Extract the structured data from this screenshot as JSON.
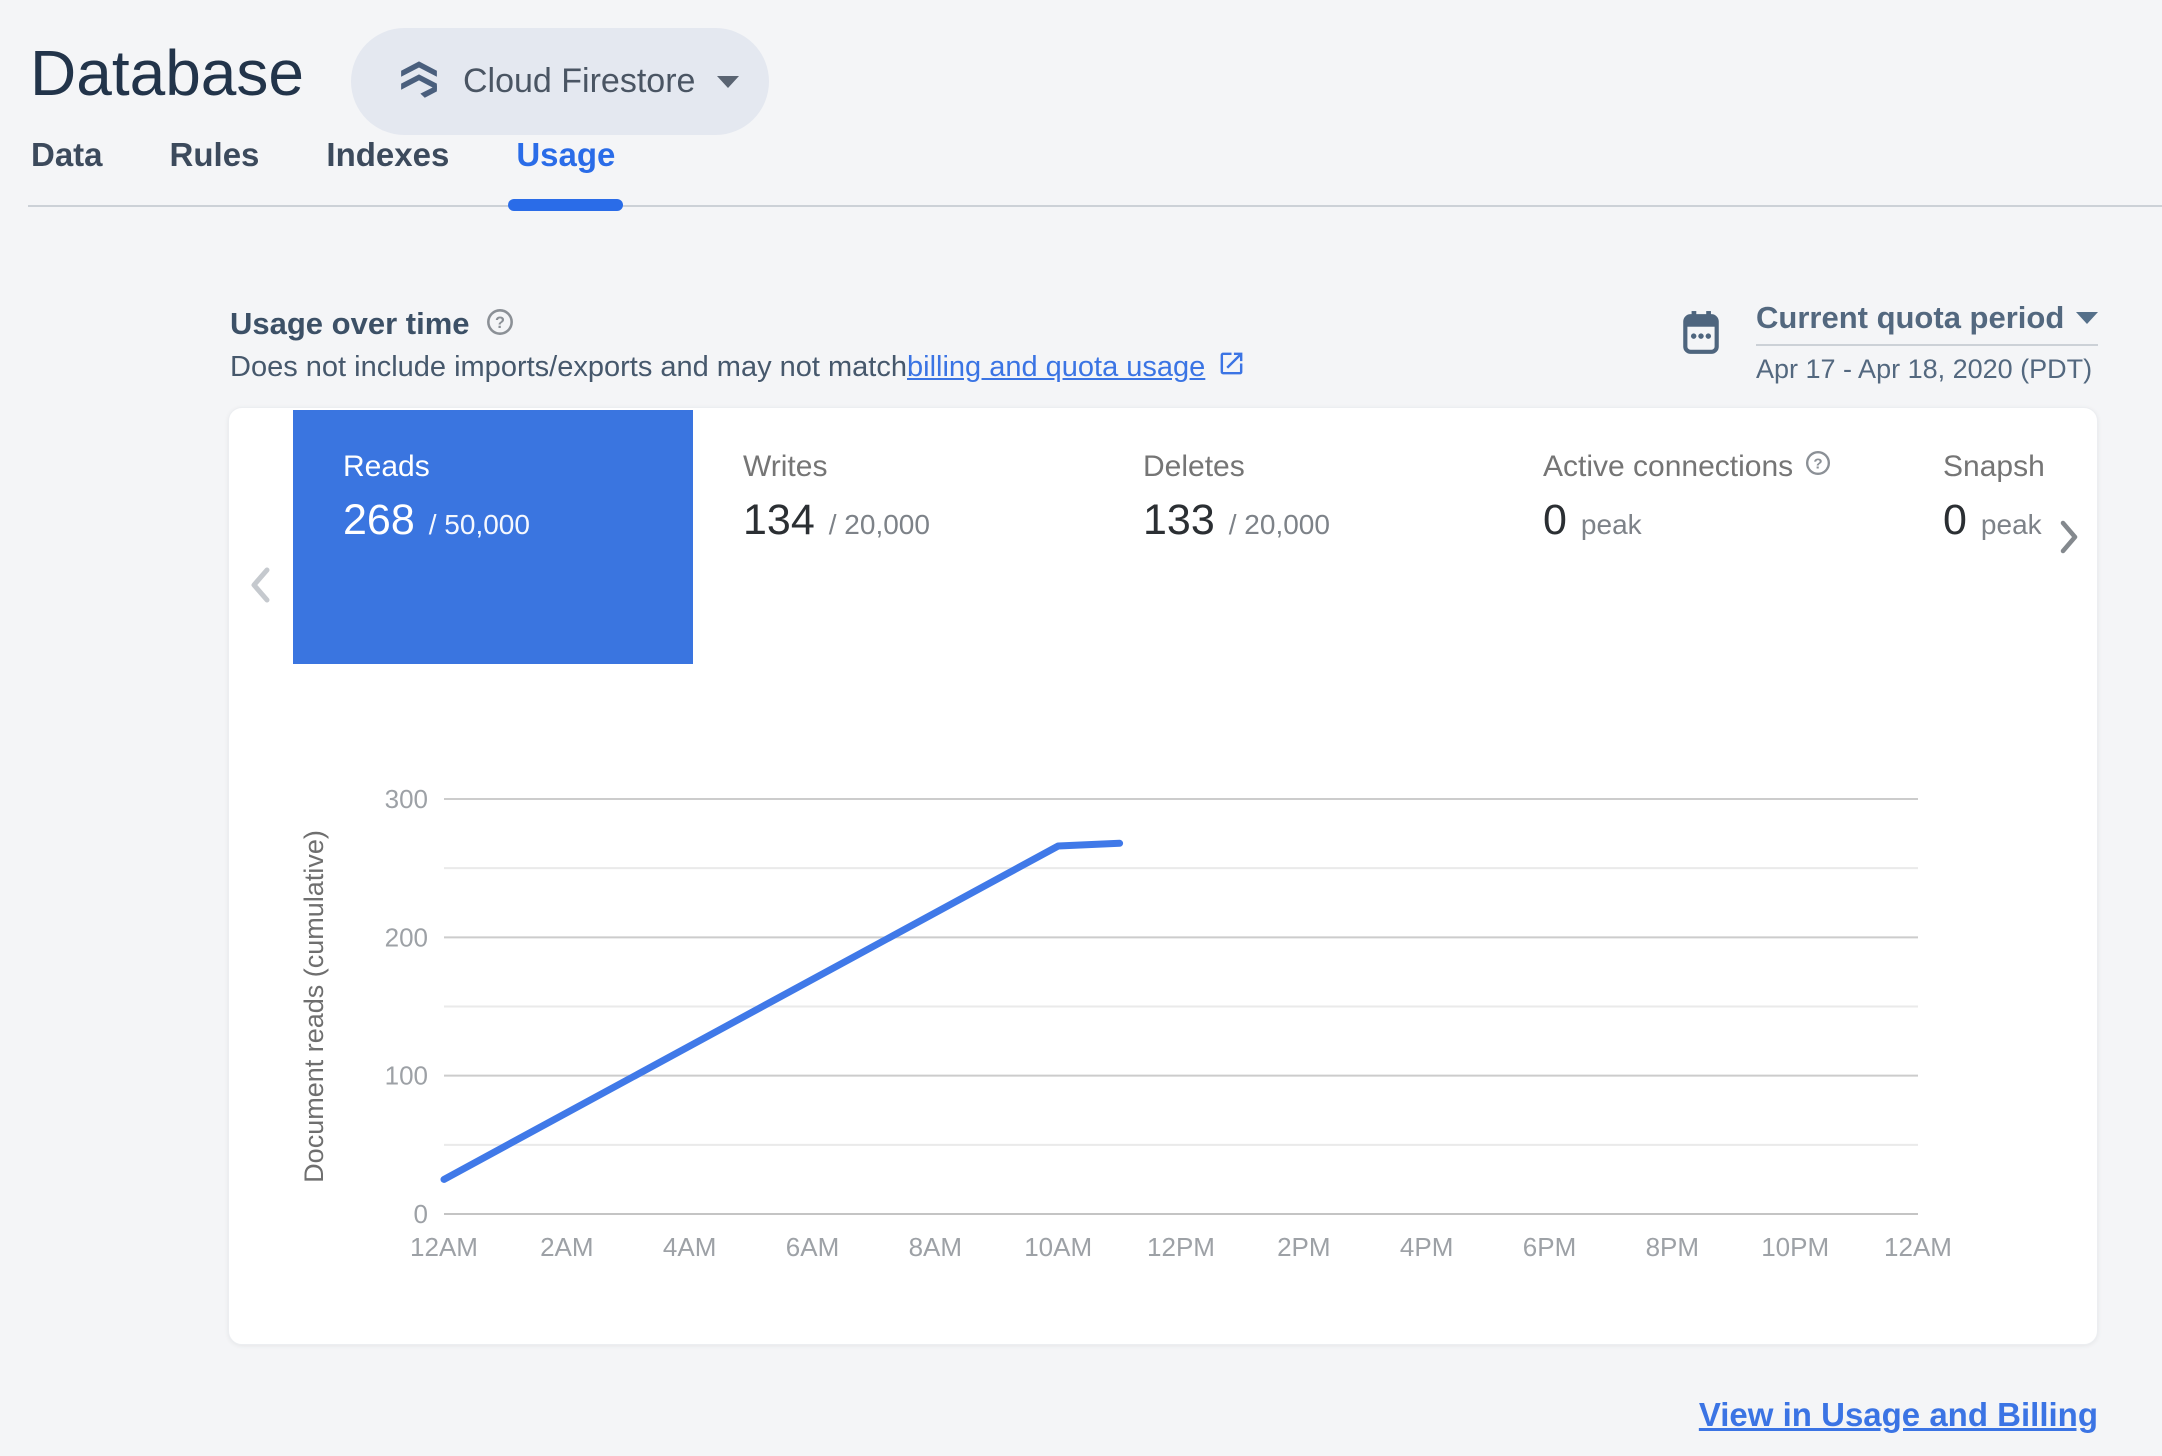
{
  "header": {
    "title": "Database",
    "product_selector": {
      "label": "Cloud Firestore"
    }
  },
  "tabs": [
    {
      "label": "Data",
      "active": false
    },
    {
      "label": "Rules",
      "active": false
    },
    {
      "label": "Indexes",
      "active": false
    },
    {
      "label": "Usage",
      "active": true
    }
  ],
  "usage_section": {
    "heading": "Usage over time",
    "subtitle_prefix": "Does not include imports/exports and may not match ",
    "subtitle_link": "billing and quota usage",
    "quota_selector": {
      "label": "Current quota period",
      "range": "Apr 17 - Apr 18, 2020 (PDT)"
    }
  },
  "metrics": [
    {
      "label": "Reads",
      "value": "268",
      "denom": "/ 50,000",
      "selected": true,
      "has_help": false
    },
    {
      "label": "Writes",
      "value": "134",
      "denom": "/ 20,000",
      "selected": false,
      "has_help": false
    },
    {
      "label": "Deletes",
      "value": "133",
      "denom": "/ 20,000",
      "selected": false,
      "has_help": false
    },
    {
      "label": "Active connections",
      "value": "0",
      "denom": "peak",
      "selected": false,
      "has_help": true
    },
    {
      "label": "Snapshot listeners",
      "value": "0",
      "denom": "peak",
      "selected": false,
      "has_help": false
    }
  ],
  "chart_data": {
    "type": "line",
    "title": "",
    "xlabel": "",
    "ylabel": "Document reads (cumulative)",
    "x_unit": "hours_since_midnight",
    "x_hours_range": [
      0,
      24
    ],
    "x_tick_labels": [
      "12AM",
      "2AM",
      "4AM",
      "6AM",
      "8AM",
      "10AM",
      "12PM",
      "2PM",
      "4PM",
      "6PM",
      "8PM",
      "10PM",
      "12AM"
    ],
    "ylim": [
      0,
      300
    ],
    "y_ticks": [
      0,
      100,
      200,
      300
    ],
    "y_minor_ticks": [
      50,
      150,
      250
    ],
    "grid": "horizontal-only",
    "legend": "none",
    "series": [
      {
        "name": "Reads",
        "color": "#4079e8",
        "points": [
          [
            0,
            25
          ],
          [
            10,
            266
          ],
          [
            11,
            268
          ]
        ]
      }
    ]
  },
  "footer": {
    "link_label": "View in Usage and Billing"
  },
  "colors": {
    "tile_selected": "#3a75e0",
    "tab_active": "#2a6ce8",
    "link_blue": "#3a74e4",
    "slate_text": "#53687f",
    "heading_text": "#3c5066",
    "grid_major": "#cccccc",
    "grid_minor": "#eaeaea",
    "axis_label": "#9da1a6"
  }
}
